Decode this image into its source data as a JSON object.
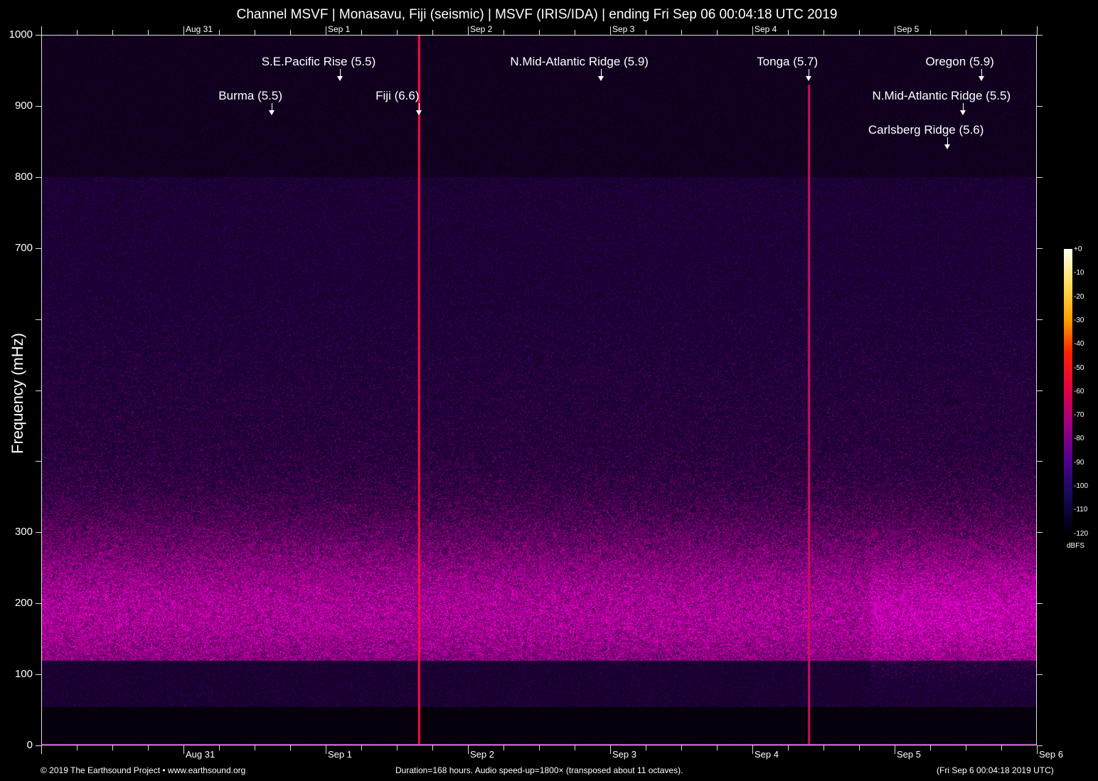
{
  "chart_data": {
    "type": "heatmap",
    "title": "Channel MSVF | Monasavu, Fiji (seismic) | MSVF (IRIS/IDA) | ending Fri Sep 06 00:04:18 UTC 2019",
    "ylabel": "Frequency (mHz)",
    "xlabel": "",
    "ylim": [
      0,
      1000
    ],
    "xlim_hours": [
      0,
      168
    ],
    "y_ticks": [
      0,
      100,
      200,
      300,
      400,
      500,
      600,
      700,
      800,
      900,
      1000
    ],
    "y_tick_labels": [
      "0",
      "100",
      "200",
      "300",
      "",
      "",
      "",
      "700",
      "800",
      "900",
      "1000"
    ],
    "x_day_labels": [
      {
        "label": "Aug 31",
        "hour": 24
      },
      {
        "label": "Sep 1",
        "hour": 48
      },
      {
        "label": "Sep 2",
        "hour": 72
      },
      {
        "label": "Sep 3",
        "hour": 96
      },
      {
        "label": "Sep 4",
        "hour": 120
      },
      {
        "label": "Sep 5",
        "hour": 144
      },
      {
        "label": "Sep 6",
        "hour": 168
      }
    ],
    "events": [
      {
        "label": "S.E.Pacific Rise (5.5)",
        "hour": 50.4
      },
      {
        "label": "N.Mid-Atlantic Ridge (5.9)",
        "hour": 94.4
      },
      {
        "label": "Tonga (5.7)",
        "hour": 129.5
      },
      {
        "label": "Oregon (5.9)",
        "hour": 158.6
      },
      {
        "label": "Burma (5.5)",
        "hour": 38.9
      },
      {
        "label": "Fiji (6.6)",
        "hour": 63.7
      },
      {
        "label": "N.Mid-Atlantic Ridge (5.5)",
        "hour": 155.5
      },
      {
        "label": "Carlsberg Ridge (5.6)",
        "hour": 152.9
      }
    ],
    "colorbar": {
      "label": "dBFS",
      "ticks": [
        "+0",
        "-10",
        "-20",
        "-30",
        "-40",
        "-50",
        "-60",
        "-70",
        "-80",
        "-90",
        "-100",
        "-110",
        "-120"
      ],
      "range": [
        -120,
        0
      ]
    }
  },
  "footer": {
    "left": "© 2019 The Earthsound Project • www.earthsound.org",
    "center": "Duration=168 hours. Audio speed-up=1800× (transposed about 11 octaves).",
    "right": "(Fri Sep  6 00:04:18 2019 UTC)"
  }
}
